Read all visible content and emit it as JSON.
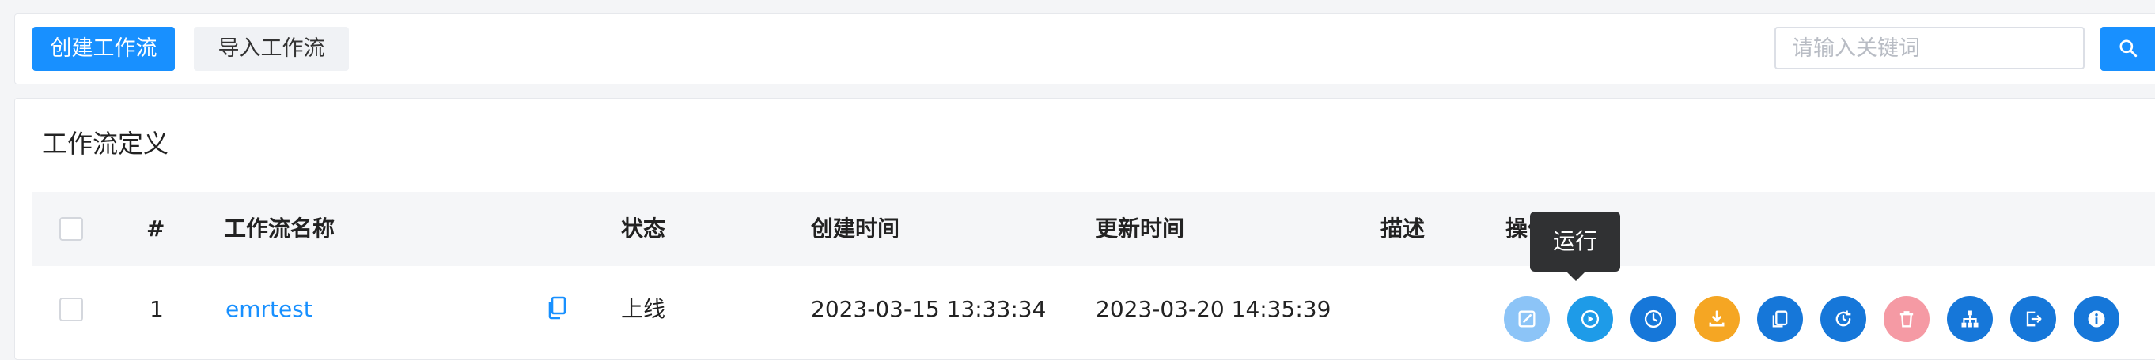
{
  "toolbar": {
    "create_label": "创建工作流",
    "import_label": "导入工作流",
    "search_placeholder": "请输入关键词",
    "search_value": ""
  },
  "panel": {
    "title": "工作流定义"
  },
  "table": {
    "columns": {
      "index": "#",
      "name": "工作流名称",
      "state": "状态",
      "create_time": "创建时间",
      "update_time": "更新时间",
      "description": "描述",
      "operations": "操作"
    },
    "rows": [
      {
        "index": "1",
        "name": "emrtest",
        "state": "上线",
        "create_time": "2023-03-15 13:33:34",
        "update_time": "2023-03-20 14:35:39",
        "description": ""
      }
    ]
  },
  "operations": [
    {
      "icon": "edit-icon",
      "color": "#8cc4f7"
    },
    {
      "icon": "play-icon",
      "color": "#1e9be8"
    },
    {
      "icon": "clock-icon",
      "color": "#1677d9"
    },
    {
      "icon": "download-icon",
      "color": "#f5a623"
    },
    {
      "icon": "copy-icon",
      "color": "#1677d9"
    },
    {
      "icon": "history-icon",
      "color": "#1677d9"
    },
    {
      "icon": "trash-icon",
      "color": "#f59aa4"
    },
    {
      "icon": "tree-icon",
      "color": "#1677d9"
    },
    {
      "icon": "export-icon",
      "color": "#1677d9"
    },
    {
      "icon": "info-icon",
      "color": "#1677d9"
    }
  ],
  "tooltip": {
    "text": "运行"
  },
  "colors": {
    "primary": "#1890ff",
    "tooltip_bg": "#303133"
  }
}
